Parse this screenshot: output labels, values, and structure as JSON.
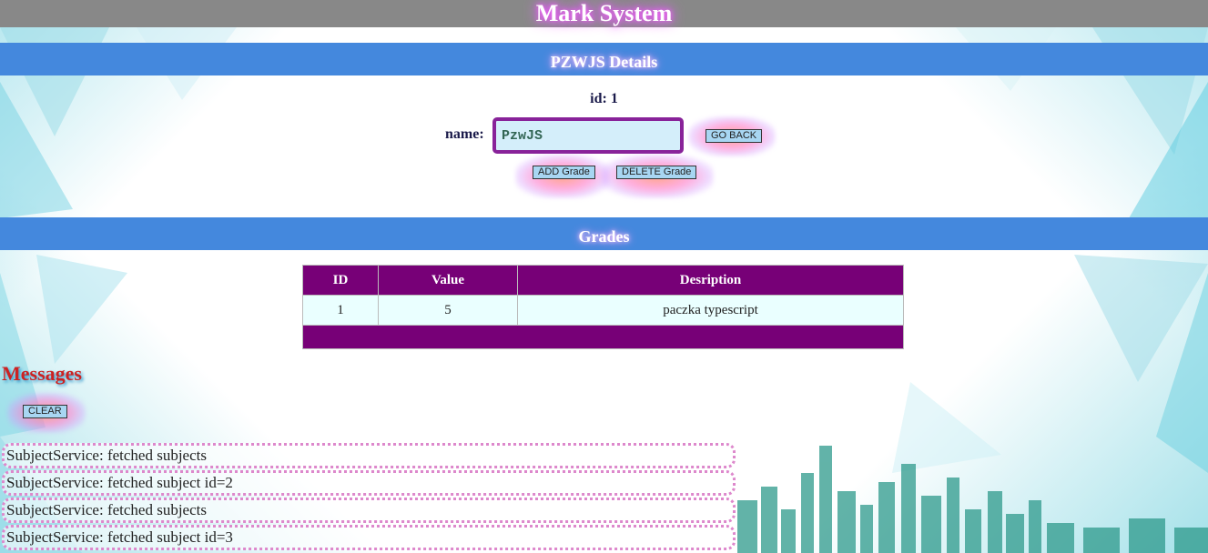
{
  "app": {
    "title": "Mark System"
  },
  "details": {
    "heading": "PZWJS Details",
    "id_text": "id: 1",
    "name_label": "name:",
    "name_value": "PzwJS",
    "go_back_label": "GO BACK",
    "add_grade_label": "ADD Grade",
    "delete_grade_label": "DELETE Grade"
  },
  "grades": {
    "heading": "Grades",
    "columns": [
      "ID",
      "Value",
      "Desription"
    ],
    "rows": [
      {
        "id": "1",
        "value": "5",
        "description": "paczka typescript"
      }
    ]
  },
  "messages": {
    "title": "Messages",
    "clear_label": "CLEAR",
    "items": [
      "SubjectService: fetched subjects",
      "SubjectService: fetched subject id=2",
      "SubjectService: fetched subjects",
      "SubjectService: fetched subject id=3"
    ]
  },
  "colors": {
    "header_bar": "#888888",
    "section_bar": "#4488dd",
    "table_header": "#770077",
    "messages_title": "#cc2222"
  }
}
